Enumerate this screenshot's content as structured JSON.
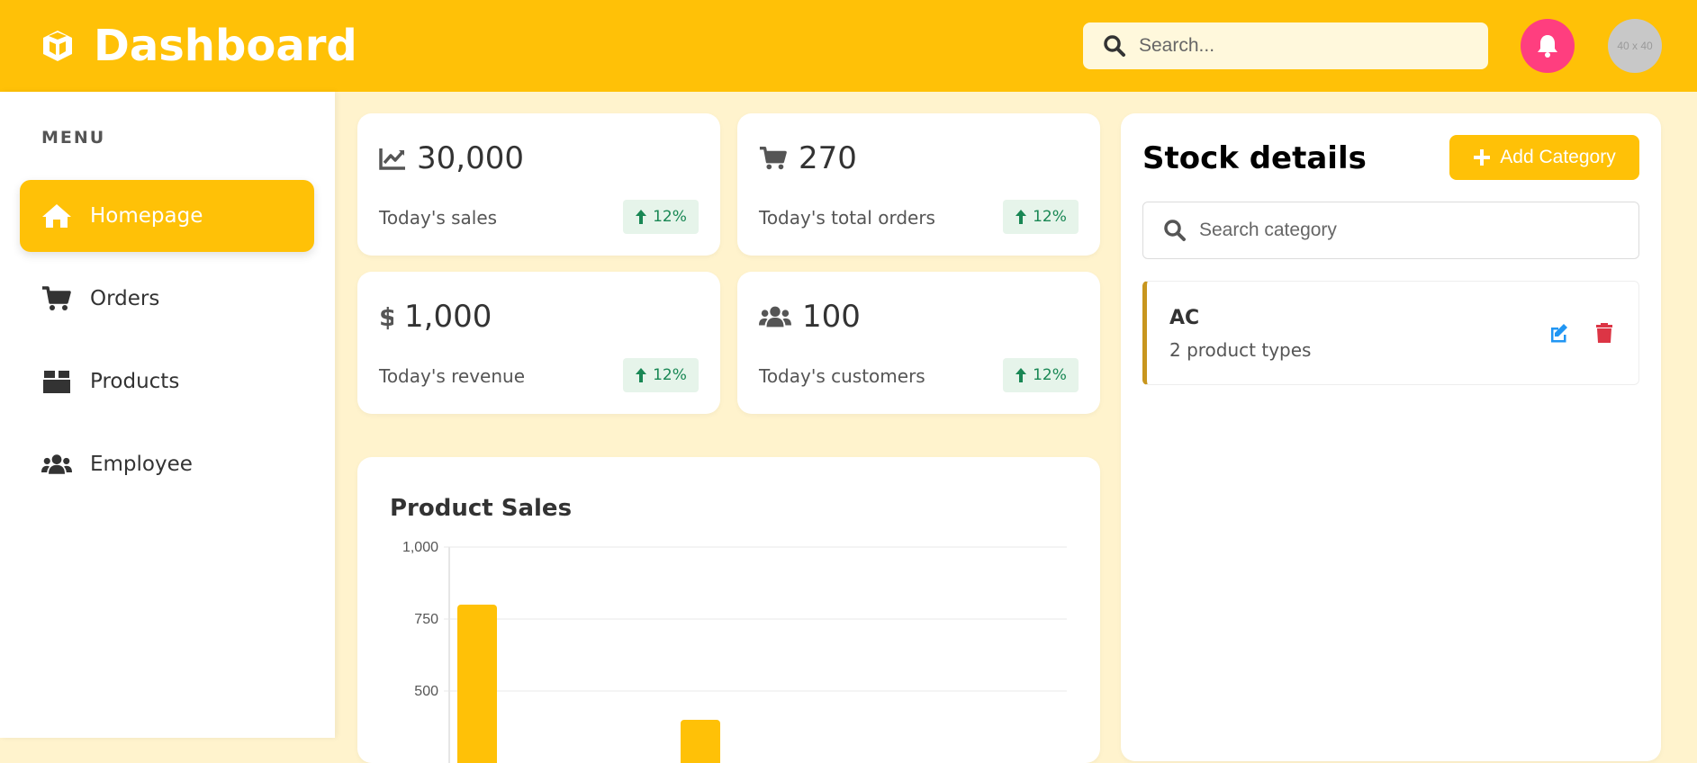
{
  "header": {
    "title": "Dashboard",
    "search_placeholder": "Search...",
    "avatar_text": "40 x 40",
    "brand_color": "#ffc107",
    "bell_color": "#ff3e7f"
  },
  "sidebar": {
    "menu_title": "MENU",
    "items": [
      {
        "label": "Homepage",
        "icon": "home-icon",
        "active": true
      },
      {
        "label": "Orders",
        "icon": "cart-icon",
        "active": false
      },
      {
        "label": "Products",
        "icon": "box-icon",
        "active": false
      },
      {
        "label": "Employee",
        "icon": "users-icon",
        "active": false
      }
    ]
  },
  "stats": [
    {
      "value": "30,000",
      "label": "Today's sales",
      "change": "12%",
      "icon": "chart-line-icon"
    },
    {
      "value": "270",
      "label": "Today's total orders",
      "change": "12%",
      "icon": "cart-icon"
    },
    {
      "value": "1,000",
      "label": "Today's revenue",
      "change": "12%",
      "icon": "dollar-icon"
    },
    {
      "value": "100",
      "label": "Today's customers",
      "change": "12%",
      "icon": "users-icon"
    }
  ],
  "sales_chart": {
    "title": "Product Sales"
  },
  "chart_data": {
    "type": "bar",
    "title": "Product Sales",
    "ytick_labels": [
      "1,000",
      "750",
      "500"
    ],
    "ylim": [
      0,
      1000
    ],
    "values": [
      800,
      400
    ],
    "color": "#ffc107",
    "grid": true
  },
  "stock": {
    "title": "Stock details",
    "add_button_label": "Add Category",
    "search_placeholder": "Search category",
    "categories": [
      {
        "name": "AC",
        "subtitle": "2 product types"
      }
    ]
  }
}
